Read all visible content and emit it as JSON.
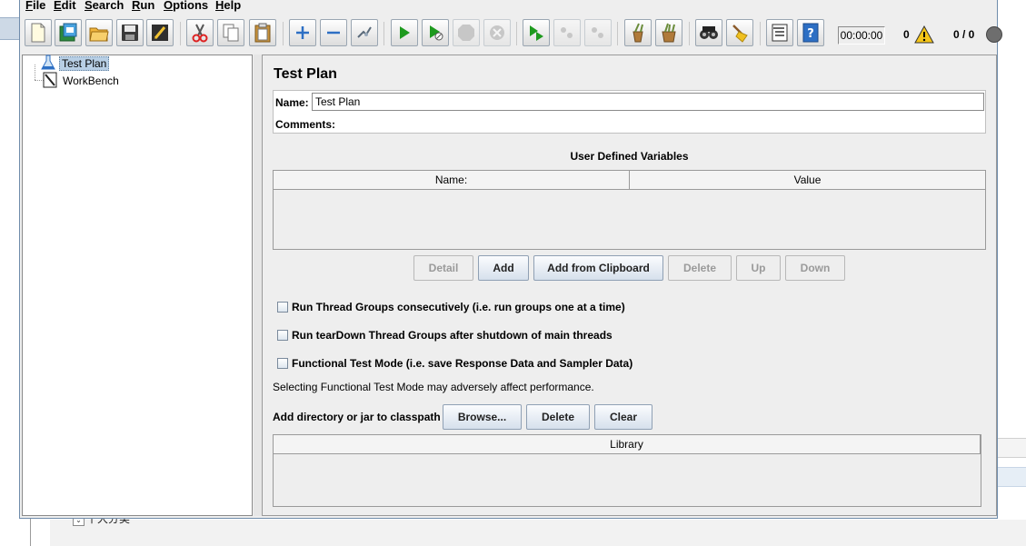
{
  "menu": [
    "File",
    "Edit",
    "Search",
    "Run",
    "Options",
    "Help"
  ],
  "menu_mnemonics": [
    "F",
    "E",
    "S",
    "R",
    "O",
    "H"
  ],
  "status": {
    "elapsed_time": "00:00:00",
    "error_count": "0",
    "active_threads": "0 / 0"
  },
  "tree": {
    "items": [
      "Test Plan",
      "WorkBench"
    ],
    "selected": "Test Plan"
  },
  "panel": {
    "title": "Test Plan",
    "name_label": "Name:",
    "name_value": "Test Plan",
    "comments_label": "Comments:",
    "udv_title": "User Defined Variables",
    "udv_columns": [
      "Name:",
      "Value"
    ],
    "udv_buttons": [
      "Detail",
      "Add",
      "Add from Clipboard",
      "Delete",
      "Up",
      "Down"
    ],
    "checkboxes": [
      "Run Thread Groups consecutively (i.e. run groups one at a time)",
      "Run tearDown Thread Groups after shutdown of main threads",
      "Functional Test Mode (i.e. save Response Data and Sampler Data)"
    ],
    "note": "Selecting Functional Test Mode may adversely affect performance.",
    "classpath_label": "Add directory or jar to classpath",
    "classpath_buttons": [
      "Browse...",
      "Delete",
      "Clear"
    ],
    "library_column": "Library"
  },
  "background": {
    "label": "十大分类"
  },
  "colors": {
    "window_bg": "#eeeeee",
    "selection_bg": "#b8cfe5",
    "button_top": "#fbfcfe",
    "button_bottom": "#d6e0ec",
    "border": "#9a9a9a",
    "run_green": "#1e9a1e"
  }
}
